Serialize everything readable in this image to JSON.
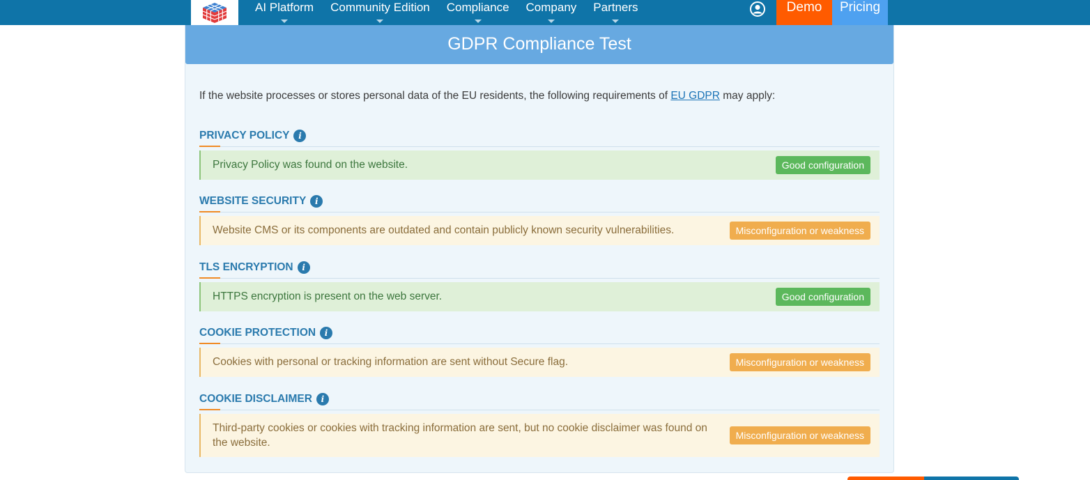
{
  "nav": {
    "items": [
      {
        "label": "AI Platform"
      },
      {
        "label": "Community Edition"
      },
      {
        "label": "Compliance"
      },
      {
        "label": "Company"
      },
      {
        "label": "Partners"
      }
    ],
    "demo_label": "Demo",
    "pricing_label": "Pricing"
  },
  "panel": {
    "title": "GDPR Compliance Test",
    "intro_before": "If the website processes or stores personal data of the EU residents, the following requirements of ",
    "intro_link": "EU GDPR",
    "intro_after": " may apply:"
  },
  "sections": [
    {
      "title": "PRIVACY POLICY",
      "message": "Privacy Policy was found on the website.",
      "status": "Good configuration",
      "state": "good"
    },
    {
      "title": "WEBSITE SECURITY",
      "message": "Website CMS or its components are outdated and contain publicly known security vulnerabilities.",
      "status": "Misconfiguration or weakness",
      "state": "warn"
    },
    {
      "title": "TLS ENCRYPTION",
      "message": "HTTPS encryption is present on the web server.",
      "status": "Good configuration",
      "state": "good"
    },
    {
      "title": "COOKIE PROTECTION",
      "message": "Cookies with personal or tracking information are sent without Secure flag.",
      "status": "Misconfiguration or weakness",
      "state": "warn"
    },
    {
      "title": "COOKIE DISCLAIMER",
      "message": "Third-party cookies or cookies with tracking information are sent, but no cookie disclaimer was found on the website.",
      "status": "Misconfiguration or weakness",
      "state": "warn"
    }
  ],
  "colors": {
    "topbar": "#0f74a8",
    "demo": "#ff5b00",
    "pricing": "#4ea1f0",
    "panel_header": "#67a9e1",
    "good_badge": "#5cb85c",
    "warn_badge": "#f0ad4e"
  }
}
